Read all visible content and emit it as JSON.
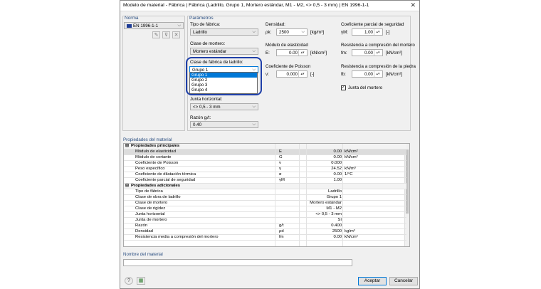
{
  "window": {
    "title": "Modelo de material - Fábrica | Fábrica (Ladrillo, Grupo 1, Mortero estándar, M1 - M2, <> 0,5 - 3 mm) | EN 1996-1-1"
  },
  "norma": {
    "header": "Norma",
    "value": "EN 1996-1-1"
  },
  "parametros": {
    "header": "Parámetros",
    "tipo_fabrica": {
      "label": "Tipo de fábrica:",
      "value": "Ladrillo"
    },
    "clase_mortero": {
      "label": "Clase de mortero:",
      "value": "Mortero estándar"
    },
    "clase_ladrillo": {
      "label": "Clase de fábrica de ladrillo:",
      "value": "Grupo 1",
      "options": [
        "Grupo 1",
        "Grupo 2",
        "Grupo 3",
        "Grupo 4"
      ]
    },
    "junta_horizontal": {
      "label": "Junta horizontal:",
      "value": "<> 0,5 - 3 mm"
    },
    "razon": {
      "label": "Razón gᵢ/t:",
      "value": "0.40"
    },
    "densidad": {
      "label": "Densidad:",
      "sym": "ρk:",
      "value": "2500",
      "unit": "[kg/m³]"
    },
    "modulo_elasticidad": {
      "label": "Módulo de elasticidad",
      "sym": "E:",
      "value": "0.00",
      "unit": "[kN/cm²]"
    },
    "poisson": {
      "label": "Coeficiente de Poisson",
      "sym": "ν:",
      "value": "0.000",
      "unit": "[-]"
    },
    "coef_seguridad": {
      "label": "Coeficiente parcial de seguridad",
      "sym": "γM:",
      "value": "1.00",
      "unit": "[-]"
    },
    "res_mortero": {
      "label": "Resistencia a compresión del mortero",
      "sym": "fm:",
      "value": "0.00",
      "unit": "[kN/cm²]"
    },
    "res_piedra": {
      "label": "Resistencia a compresión de la piedra",
      "sym": "fb:",
      "value": "0.00",
      "unit": "[kN/cm²]"
    },
    "junta_mortero": {
      "label": "Junta del mortero",
      "checked": true
    }
  },
  "propiedades": {
    "header": "Propiedades del material",
    "principales_title": "Propiedades principales",
    "principales": [
      {
        "name": "Módulo de elasticidad",
        "sym": "E",
        "value": "0.00",
        "unit": "kN/cm²"
      },
      {
        "name": "Módulo de cortante",
        "sym": "G",
        "value": "0.00",
        "unit": "kN/cm²"
      },
      {
        "name": "Coeficiente de Poisson",
        "sym": "ν",
        "value": "0.000",
        "unit": ""
      },
      {
        "name": "Peso específico",
        "sym": "γ",
        "value": "24.52",
        "unit": "kN/m³"
      },
      {
        "name": "Coeficiente de dilatación térmica",
        "sym": "α",
        "value": "0.00",
        "unit": "1/°C"
      },
      {
        "name": "Coeficiente parcial de seguridad",
        "sym": "γM",
        "value": "1.00",
        "unit": ""
      }
    ],
    "adicionales_title": "Propiedades adicionales",
    "adicionales": [
      {
        "name": "Tipo de fábrica",
        "sym": "",
        "value": "Ladrillo",
        "unit": ""
      },
      {
        "name": "Clase de obra de ladrillo",
        "sym": "",
        "value": "Grupo 1",
        "unit": ""
      },
      {
        "name": "Clase de mortero",
        "sym": "",
        "value": "Mortero estándar",
        "unit": ""
      },
      {
        "name": "Clase de rigidez",
        "sym": "",
        "value": "M1 - M2",
        "unit": ""
      },
      {
        "name": "Junta horizontal",
        "sym": "",
        "value": "<> 0,5 - 3 mm",
        "unit": ""
      },
      {
        "name": "Junta de mortero",
        "sym": "",
        "value": "Sí",
        "unit": ""
      },
      {
        "name": "Razón",
        "sym": "g/t",
        "value": "0.400",
        "unit": ""
      },
      {
        "name": "Densidad",
        "sym": "ρd",
        "value": "2500",
        "unit": "kg/m³"
      },
      {
        "name": "Resistencia media a compresión del mortero",
        "sym": "fm",
        "value": "0.00",
        "unit": "kN/cm²"
      }
    ]
  },
  "nombre": {
    "header": "Nombre del material",
    "value": ""
  },
  "buttons": {
    "accept": "Aceptar",
    "cancel": "Cancelar"
  },
  "colors": {
    "accent": "#0078d7",
    "highlight": "#1f3fa8",
    "header": "#2b4f82"
  }
}
